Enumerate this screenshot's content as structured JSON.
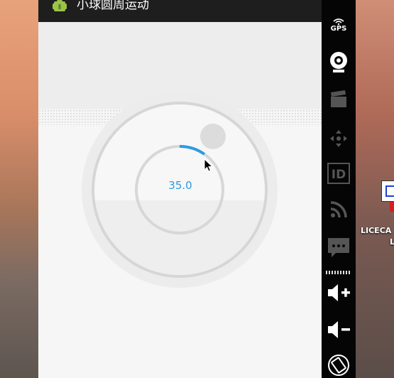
{
  "app": {
    "title": "小球圆周运动",
    "icon": "android-icon"
  },
  "dial": {
    "value_text": "35.0",
    "progress_fraction": 0.097,
    "accent_color": "#2d9be0"
  },
  "toolbar": {
    "gps_label": "GPS",
    "items": [
      "gps-icon",
      "webcam-icon",
      "clapperboard-icon",
      "dpad-icon",
      "id-icon",
      "rss-icon",
      "chat-icon",
      "volume-up-icon",
      "volume-down-icon",
      "rotate-icon"
    ]
  },
  "desktop": {
    "label_line1": "LICECA",
    "label_line2": "L"
  }
}
